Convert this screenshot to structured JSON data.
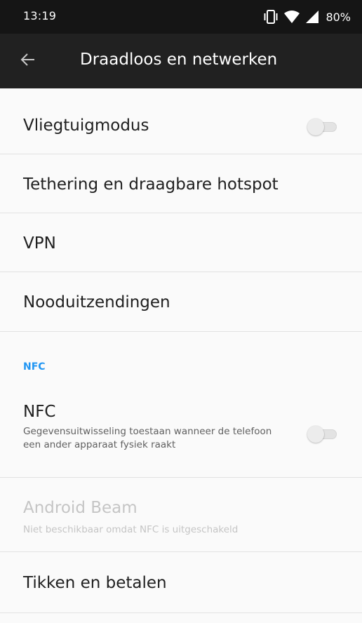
{
  "status_bar": {
    "time": "13:19",
    "battery": "80%"
  },
  "toolbar": {
    "title": "Draadloos en netwerken"
  },
  "settings": {
    "airplane_mode": {
      "title": "Vliegtuigmodus",
      "enabled": false
    },
    "tethering": {
      "title": "Tethering en draagbare hotspot"
    },
    "vpn": {
      "title": "VPN"
    },
    "emergency_broadcasts": {
      "title": "Nooduitzendingen"
    },
    "nfc_section": {
      "header": "NFC",
      "accent_color": "#2196f3"
    },
    "nfc": {
      "title": "NFC",
      "summary": "Gegevensuitwisseling toestaan wanneer de telefoon een ander apparaat fysiek raakt",
      "enabled": false
    },
    "android_beam": {
      "title": "Android Beam",
      "summary": "Niet beschikbaar omdat NFC is uitgeschakeld",
      "disabled": true
    },
    "tap_and_pay": {
      "title": "Tikken en betalen"
    }
  },
  "icons": {
    "back": "arrow-back-icon",
    "vibrate": "vibrate-icon",
    "wifi": "wifi-icon",
    "cell_signal": "cell-signal-icon"
  }
}
